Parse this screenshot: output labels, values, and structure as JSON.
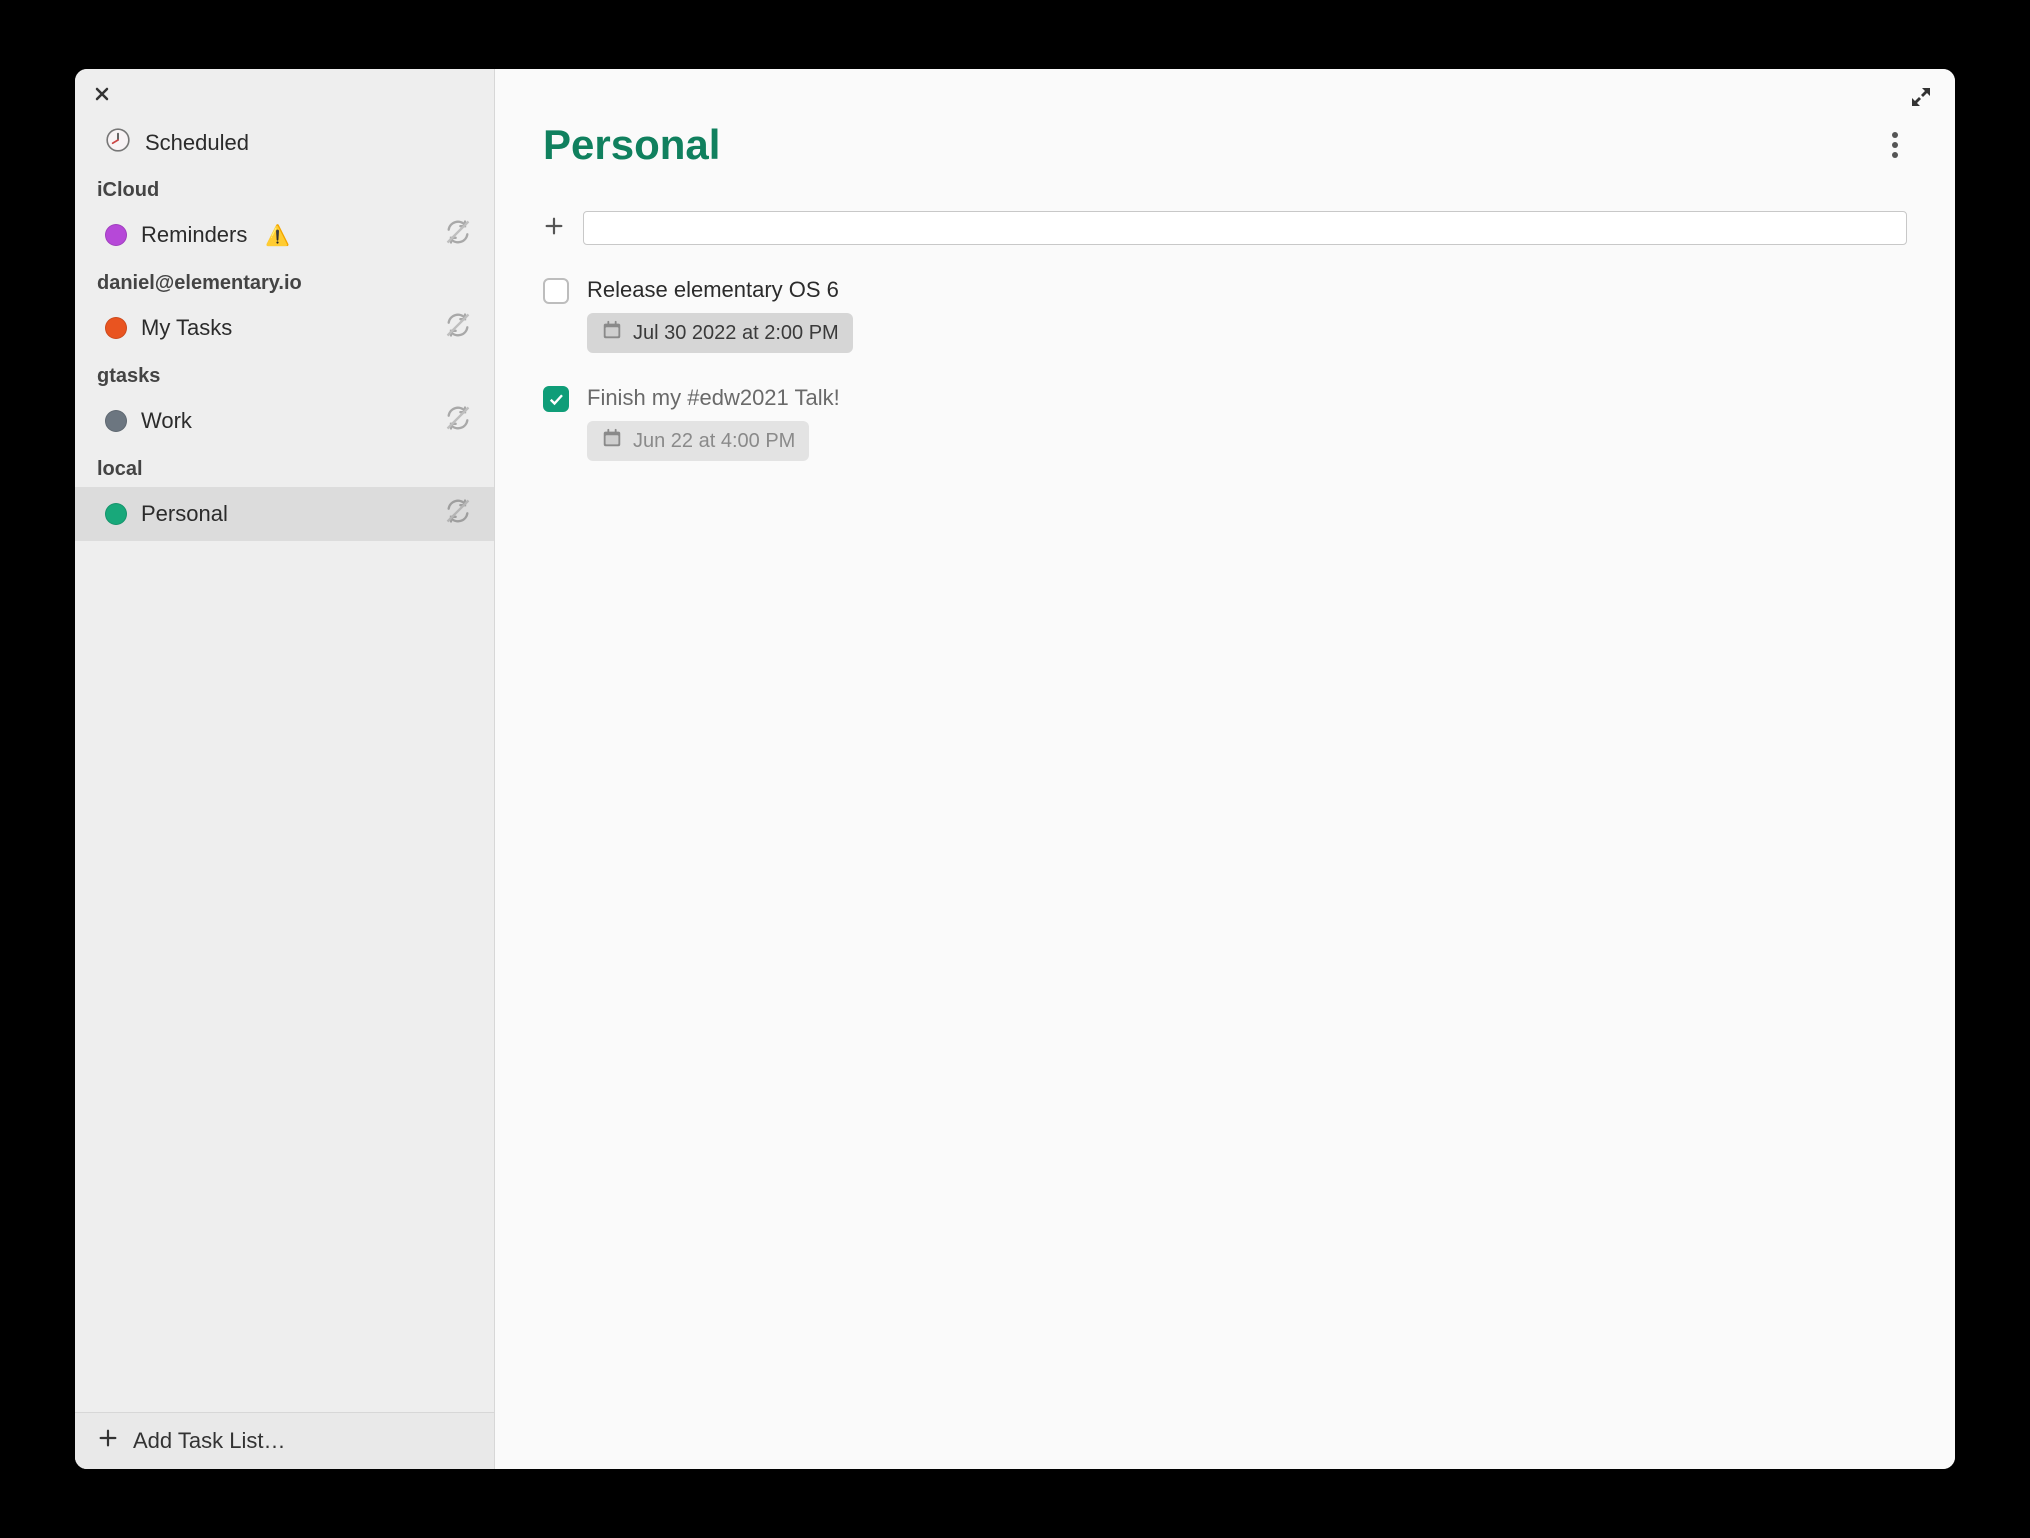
{
  "accent_color": "#10805e",
  "sidebar": {
    "scheduled_label": "Scheduled",
    "sections": [
      {
        "name": "iCloud",
        "lists": [
          {
            "label": "Reminders",
            "color": "#b648d8",
            "warning": true,
            "selected": false
          }
        ]
      },
      {
        "name": "daniel@elementary.io",
        "lists": [
          {
            "label": "My Tasks",
            "color": "#e95420",
            "warning": false,
            "selected": false
          }
        ]
      },
      {
        "name": "gtasks",
        "lists": [
          {
            "label": "Work",
            "color": "#6c7680",
            "warning": false,
            "selected": false
          }
        ]
      },
      {
        "name": "local",
        "lists": [
          {
            "label": "Personal",
            "color": "#18a87a",
            "warning": false,
            "selected": true
          }
        ]
      }
    ],
    "footer_label": "Add Task List…"
  },
  "main": {
    "title": "Personal",
    "newtask_placeholder": "",
    "tasks": [
      {
        "title": "Release elementary OS 6",
        "due": "Jul 30 2022 at 2:00 PM",
        "checked": false
      },
      {
        "title": "Finish my #edw2021 Talk!",
        "due": "Jun 22 at 4:00 PM",
        "checked": true
      }
    ]
  }
}
